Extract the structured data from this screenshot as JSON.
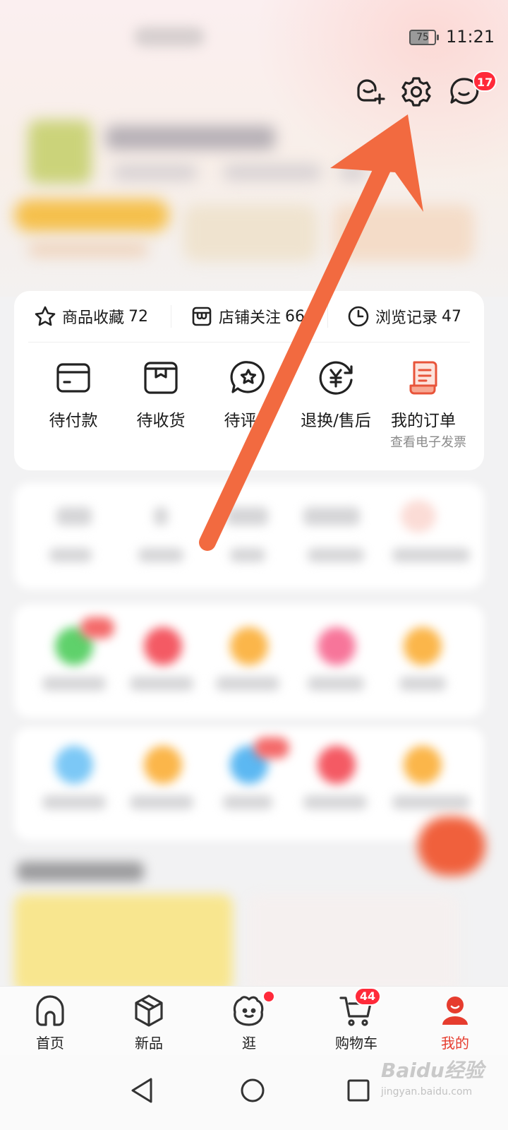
{
  "status_bar": {
    "battery": "75",
    "time": "11:21"
  },
  "header": {
    "message_badge": "17"
  },
  "stats": [
    {
      "label": "商品收藏",
      "count": "72"
    },
    {
      "label": "店铺关注",
      "count": "66"
    },
    {
      "label": "浏览记录",
      "count": "47"
    }
  ],
  "orders": [
    {
      "label": "待付款"
    },
    {
      "label": "待收货"
    },
    {
      "label": "待评价"
    },
    {
      "label": "退换/售后"
    },
    {
      "label": "我的订单",
      "sub": "查看电子发票"
    }
  ],
  "tabs": [
    {
      "label": "首页"
    },
    {
      "label": "新品"
    },
    {
      "label": "逛"
    },
    {
      "label": "购物车",
      "badge": "44"
    },
    {
      "label": "我的"
    }
  ],
  "watermark": {
    "brand": "Baidu经验",
    "url": "jingyan.baidu.com"
  },
  "colors": {
    "accent": "#e63c2e",
    "arrow": "#f26a40",
    "badge": "#ff2a3a"
  }
}
